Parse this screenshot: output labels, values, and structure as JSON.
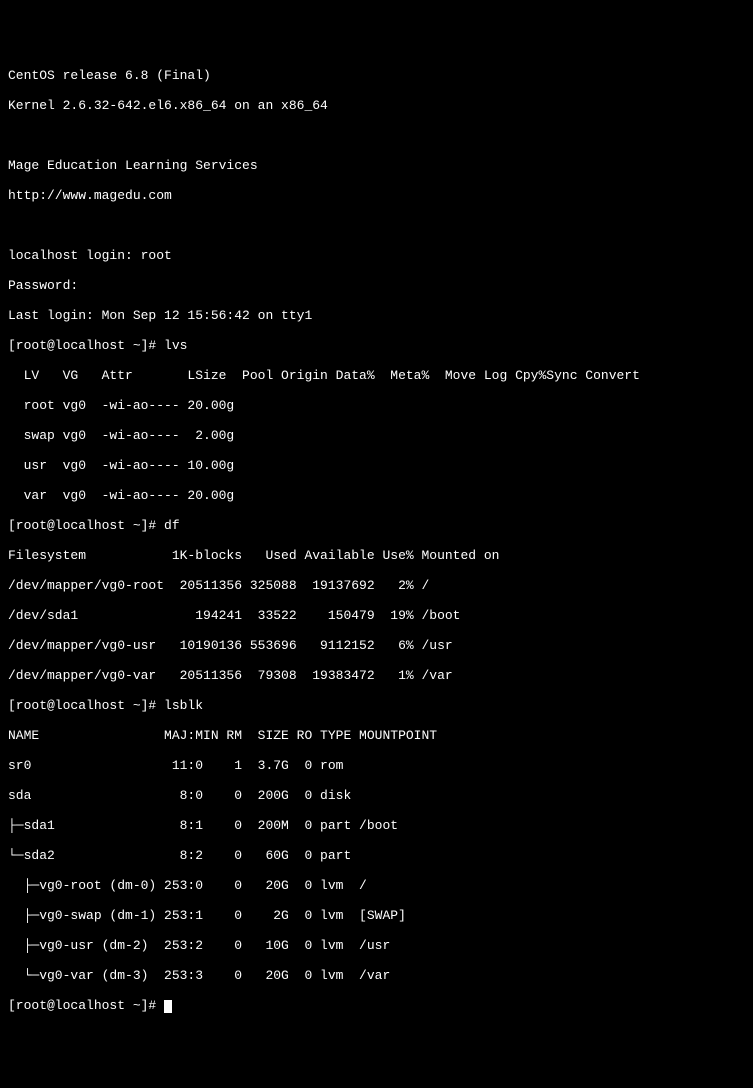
{
  "header": {
    "os_line": "CentOS release 6.8 (Final)",
    "kernel_line": "Kernel 2.6.32-642.el6.x86_64 on an x86_64",
    "org_line": "Mage Education Learning Services",
    "url_line": "http://www.magedu.com"
  },
  "login": {
    "prompt": "localhost login: root",
    "password": "Password:",
    "last_login": "Last login: Mon Sep 12 15:56:42 on tty1"
  },
  "prompt1": "[root@localhost ~]# lvs",
  "lvs": {
    "header": "  LV   VG   Attr       LSize  Pool Origin Data%  Meta%  Move Log Cpy%Sync Convert",
    "rows": [
      "  root vg0  -wi-ao---- 20.00g",
      "  swap vg0  -wi-ao----  2.00g",
      "  usr  vg0  -wi-ao---- 10.00g",
      "  var  vg0  -wi-ao---- 20.00g"
    ]
  },
  "prompt2": "[root@localhost ~]# df",
  "df": {
    "header": "Filesystem           1K-blocks   Used Available Use% Mounted on",
    "rows": [
      "/dev/mapper/vg0-root  20511356 325088  19137692   2% /",
      "/dev/sda1               194241  33522    150479  19% /boot",
      "/dev/mapper/vg0-usr   10190136 553696   9112152   6% /usr",
      "/dev/mapper/vg0-var   20511356  79308  19383472   1% /var"
    ]
  },
  "prompt3": "[root@localhost ~]# lsblk",
  "lsblk": {
    "header": "NAME                MAJ:MIN RM  SIZE RO TYPE MOUNTPOINT",
    "rows": [
      "sr0                  11:0    1  3.7G  0 rom",
      "sda                   8:0    0  200G  0 disk",
      "├─sda1                8:1    0  200M  0 part /boot",
      "└─sda2                8:2    0   60G  0 part",
      "  ├─vg0-root (dm-0) 253:0    0   20G  0 lvm  /",
      "  ├─vg0-swap (dm-1) 253:1    0    2G  0 lvm  [SWAP]",
      "  ├─vg0-usr (dm-2)  253:2    0   10G  0 lvm  /usr",
      "  └─vg0-var (dm-3)  253:3    0   20G  0 lvm  /var"
    ]
  },
  "prompt4": "[root@localhost ~]# "
}
